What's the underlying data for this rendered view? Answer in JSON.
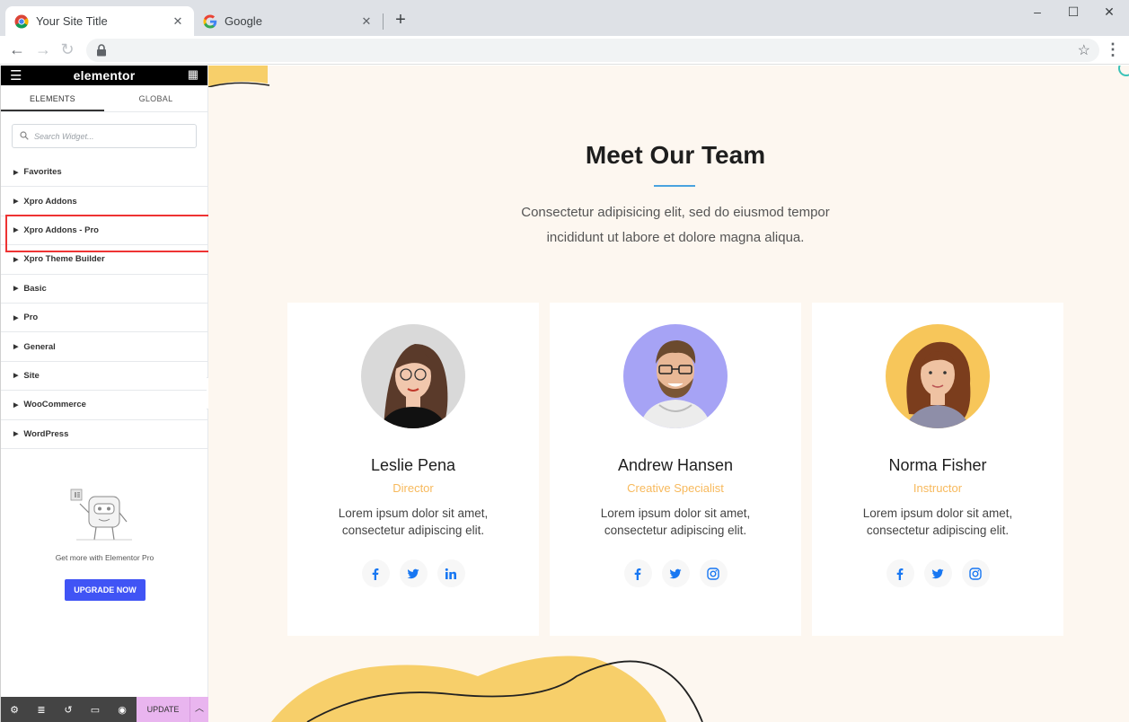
{
  "browser": {
    "tabs": [
      {
        "title": "Your Site Title",
        "close": "✕"
      },
      {
        "title": "Google",
        "close": "✕"
      }
    ],
    "new_tab": "+",
    "window_controls": {
      "minimize": "–",
      "maximize": "☐",
      "close": "✕"
    },
    "nav": {
      "back": "←",
      "forward": "→",
      "reload": "↻"
    },
    "url": "",
    "bookmark": "☆",
    "menu": "⋮"
  },
  "panel": {
    "burger": "☰",
    "logo": "elementor",
    "grid": "▦",
    "tabs": [
      "ELEMENTS",
      "GLOBAL"
    ],
    "search_placeholder": "Search Widget...",
    "categories": [
      "Favorites",
      "Xpro Addons",
      "Xpro Addons - Pro",
      "Xpro Theme Builder",
      "Basic",
      "Pro",
      "General",
      "Site",
      "WooCommerce",
      "WordPress"
    ],
    "highlighted_category": "Xpro Addons - Pro",
    "promo_text": "Get more with Elementor Pro",
    "upgrade_label": "UPGRADE NOW",
    "update_label": "UPDATE",
    "collapse": "‹",
    "footer_icons": [
      "settings-icon",
      "navigator-icon",
      "history-icon",
      "responsive-icon",
      "preview-icon"
    ]
  },
  "team": {
    "heading": "Meet Our Team",
    "intro_line1": "Consectetur adipisicing elit, sed do eiusmod tempor",
    "intro_line2": "incididunt ut labore et dolore magna aliqua.",
    "members": [
      {
        "name": "Leslie Pena",
        "role": "Director",
        "bio1": "Lorem ipsum dolor sit amet,",
        "bio2": "consectetur adipiscing elit.",
        "avatar_bg": "#d9d9d9",
        "socials": [
          "facebook",
          "twitter",
          "linkedin"
        ]
      },
      {
        "name": "Andrew Hansen",
        "role": "Creative Specialist",
        "bio1": "Lorem ipsum dolor sit amet,",
        "bio2": "consectetur adipiscing elit.",
        "avatar_bg": "#a6a3f5",
        "socials": [
          "facebook",
          "twitter",
          "instagram"
        ]
      },
      {
        "name": "Norma Fisher",
        "role": "Instructor",
        "bio1": "Lorem ipsum dolor sit amet,",
        "bio2": "consectetur adipiscing elit.",
        "avatar_bg": "#f7c65a",
        "socials": [
          "facebook",
          "twitter",
          "instagram"
        ]
      }
    ]
  },
  "colors": {
    "accent_blue": "#1877f2",
    "role_orange": "#f7b95c",
    "canvas_bg": "#fdf7f0",
    "deco_yellow": "#f7cf6a",
    "upgrade_button": "#4054f5",
    "update_button": "#e9b5ef"
  }
}
